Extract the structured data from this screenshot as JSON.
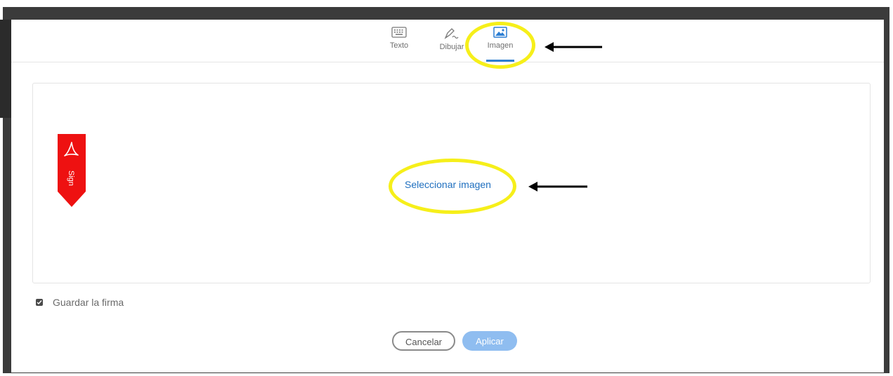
{
  "dialog": {
    "tabs": [
      {
        "id": "texto",
        "label": "Texto",
        "icon": "keyboard-icon"
      },
      {
        "id": "dibujar",
        "label": "Dibujar",
        "icon": "pen-draw-icon"
      },
      {
        "id": "imagen",
        "label": "Imagen",
        "icon": "image-icon",
        "active": true
      }
    ],
    "panel": {
      "select_image_link": "Seleccionar imagen",
      "ribbon_text": "Sign",
      "ribbon_icon": "acrobat-logo-icon"
    },
    "save_signature": {
      "label": "Guardar la firma",
      "checked": true
    },
    "buttons": {
      "cancel": "Cancelar",
      "apply": "Aplicar"
    }
  },
  "colors": {
    "accent": "#2d7fd3",
    "apply_button": "#8fbdf0",
    "highlight": "#f6ef1a",
    "ribbon": "#ee1111"
  }
}
